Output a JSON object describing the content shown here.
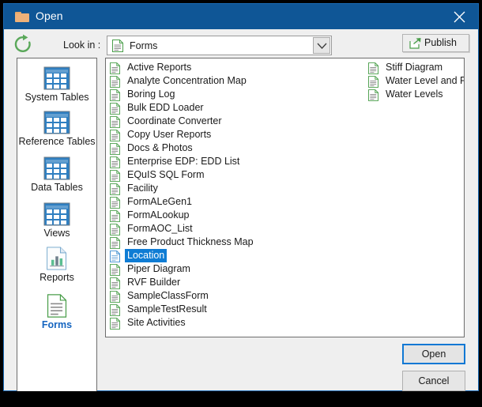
{
  "window": {
    "title": "Open",
    "title_icon": "folder-icon",
    "close_icon": "close-icon"
  },
  "toolbar": {
    "refresh_icon": "refresh-icon",
    "lookin_label": "Look in :",
    "lookin_value": "Forms",
    "lookin_icon": "document-icon",
    "dropdown_icon": "chevron-down-icon",
    "publish_label": "Publish",
    "publish_icon": "publish-arrow-icon"
  },
  "sidebar": {
    "items": [
      {
        "label": "System Tables",
        "icon": "table-grid-icon",
        "selected": false
      },
      {
        "label": "Reference Tables",
        "icon": "table-grid-icon",
        "selected": false
      },
      {
        "label": "Data Tables",
        "icon": "table-grid-icon",
        "selected": false
      },
      {
        "label": "Views",
        "icon": "table-grid-icon",
        "selected": false
      },
      {
        "label": "Reports",
        "icon": "report-chart-icon",
        "selected": false
      },
      {
        "label": "Forms",
        "icon": "form-document-icon",
        "selected": true
      }
    ]
  },
  "file_list": {
    "column_left": [
      {
        "label": "Active Reports",
        "icon": "document-icon",
        "selected": false
      },
      {
        "label": "Analyte Concentration Map",
        "icon": "document-icon",
        "selected": false
      },
      {
        "label": "Boring Log",
        "icon": "document-icon",
        "selected": false
      },
      {
        "label": "Bulk EDD Loader",
        "icon": "document-icon",
        "selected": false
      },
      {
        "label": "Coordinate Converter",
        "icon": "document-icon",
        "selected": false
      },
      {
        "label": "Copy User Reports",
        "icon": "document-icon",
        "selected": false
      },
      {
        "label": "Docs & Photos",
        "icon": "document-icon",
        "selected": false
      },
      {
        "label": "Enterprise EDP: EDD List",
        "icon": "document-icon",
        "selected": false
      },
      {
        "label": "EQuIS SQL Form",
        "icon": "document-icon",
        "selected": false
      },
      {
        "label": "Facility",
        "icon": "document-icon",
        "selected": false
      },
      {
        "label": "FormALeGen1",
        "icon": "document-icon",
        "selected": false
      },
      {
        "label": "FormALookup",
        "icon": "document-icon",
        "selected": false
      },
      {
        "label": "FormAOC_List",
        "icon": "document-icon",
        "selected": false
      },
      {
        "label": "Free Product Thickness Map",
        "icon": "document-icon",
        "selected": false
      },
      {
        "label": "Location",
        "icon": "document-icon",
        "selected": true
      },
      {
        "label": "Piper Diagram",
        "icon": "document-icon",
        "selected": false
      },
      {
        "label": "RVF Builder",
        "icon": "document-icon",
        "selected": false
      },
      {
        "label": "SampleClassForm",
        "icon": "document-icon",
        "selected": false
      },
      {
        "label": "SampleTestResult",
        "icon": "document-icon",
        "selected": false
      },
      {
        "label": "Site Activities",
        "icon": "document-icon",
        "selected": false
      }
    ],
    "column_right": [
      {
        "label": "Stiff Diagram",
        "icon": "document-icon",
        "selected": false
      },
      {
        "label": "Water Level and Particle Tracking Map",
        "icon": "document-icon",
        "selected": false
      },
      {
        "label": "Water Levels",
        "icon": "document-icon",
        "selected": false
      }
    ]
  },
  "buttons": {
    "open_label": "Open",
    "cancel_label": "Cancel"
  },
  "colors": {
    "titlebar": "#0f5696",
    "selection": "#0f7cd4",
    "accent_green": "#4a9e4a",
    "focus_border": "#0f78d4",
    "sidebar_selected_text": "#1565c0"
  }
}
